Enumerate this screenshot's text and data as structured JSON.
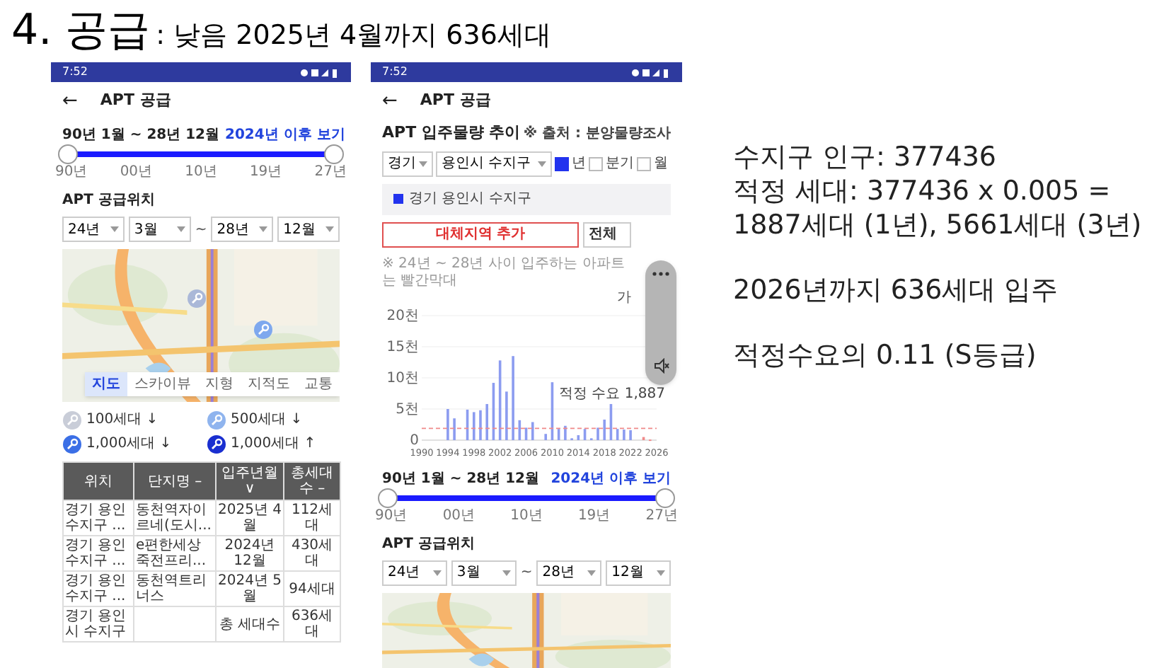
{
  "slide": {
    "title": "4. 공급",
    "subtitle": ": 낮음 2025년 4월까지 636세대"
  },
  "left_phone": {
    "status_bar": {
      "time": "7:52"
    },
    "header": {
      "back": "←",
      "title": "APT 공급"
    },
    "range": {
      "label": "90년 1월 ~ 28년 12월",
      "link": "2024년 이후 보기",
      "level": 1,
      "ticks": [
        "90년",
        "00년",
        "10년",
        "19년",
        "27년"
      ]
    },
    "location_title": "APT 공급위치",
    "period_selects": [
      "24년",
      "3월",
      "28년",
      "12월"
    ],
    "separator": "~",
    "map_tabs": [
      {
        "label": "지도",
        "selected": true
      },
      {
        "label": "스카이뷰",
        "selected": false
      },
      {
        "label": "지형",
        "selected": false
      },
      {
        "label": "지적도",
        "selected": false
      },
      {
        "label": "교통",
        "selected": false
      }
    ],
    "legend": [
      {
        "label": "100세대 ↓",
        "color": "#c9cdd8"
      },
      {
        "label": "500세대 ↓",
        "color": "#8fb4ee"
      },
      {
        "label": "1,000세대 ↓",
        "color": "#3b6fe6"
      },
      {
        "label": "1,000세대 ↑",
        "color": "#1a2fd0"
      }
    ],
    "table": {
      "columns": [
        "위치",
        "단지명 –",
        "입주년월 ∨",
        "총세대수 –"
      ],
      "rows": [
        [
          "경기 용인 수지구 ...",
          "동천역자이르네(도시...",
          "2025년 4월",
          "112세대"
        ],
        [
          "경기 용인 수지구 ...",
          "e편한세상죽전프리...",
          "2024년 12월",
          "430세대"
        ],
        [
          "경기 용인 수지구 ...",
          "동천역트리너스",
          "2024년 5월",
          "94세대"
        ]
      ],
      "total": {
        "location": "경기 용인시 수지구",
        "label": "총 세대수",
        "value": "636세대"
      }
    }
  },
  "middle_phone": {
    "status_bar": {
      "time": "7:52"
    },
    "header": {
      "back": "←",
      "title": "APT 공급"
    },
    "chart_title": "APT 입주물량 추이",
    "source": "※ 출처 : 분양물량조사",
    "region_selects": [
      "경기",
      "용인시 수지구"
    ],
    "periods": [
      {
        "label": "년",
        "checked": true
      },
      {
        "label": "분기",
        "checked": false
      },
      {
        "label": "월",
        "checked": false
      }
    ],
    "add_region_button": "대체지역 추가",
    "all_button": "전체",
    "note": "※ 24년 ~ 28년 사이 입주하는 아파트는 빨간막대",
    "chart_corner_text": "가",
    "chart": {
      "chart_data": {
        "type": "bar",
        "ylim": [
          0,
          20
        ],
        "xlim": [
          1990,
          2026
        ],
        "grid": true,
        "stacked": true,
        "yticks": [
          {
            "value": 0,
            "label": "0"
          },
          {
            "value": 5,
            "label": "5천"
          },
          {
            "value": 10,
            "label": "10천"
          },
          {
            "value": 15,
            "label": "15천"
          },
          {
            "value": 20,
            "label": "20천"
          }
        ],
        "xticks": [
          1990,
          1994,
          1998,
          2002,
          2006,
          2010,
          2014,
          2018,
          2022,
          2026
        ],
        "x": [
          1994,
          1995,
          1996,
          1997,
          1998,
          1999,
          2000,
          2001,
          2002,
          2003,
          2004,
          2005,
          2006,
          2007,
          2008,
          2009,
          2010,
          2011,
          2012,
          2013,
          2014,
          2015,
          2016,
          2017,
          2018,
          2019,
          2020,
          2021,
          2022,
          2023,
          2024,
          2025
        ],
        "series": [
          {
            "name": "경기 용인시 수지구",
            "color": "#8c9cf0",
            "values": [
              5,
              3.5,
              null,
              4.9,
              4.5,
              4.8,
              5.8,
              9.2,
              12.8,
              7.8,
              13.5,
              3.2,
              2,
              2.9,
              null,
              1,
              9.3,
              1.8,
              2.3,
              0.3,
              0.8,
              1.8,
              0.3,
              2,
              3.3,
              5.8,
              1.8,
              1.7,
              1.6,
              null,
              null,
              null
            ]
          },
          {
            "color": "#f08a8a",
            "values": [
              null,
              null,
              null,
              null,
              null,
              null,
              null,
              null,
              null,
              null,
              null,
              null,
              null,
              null,
              null,
              null,
              null,
              null,
              null,
              null,
              null,
              null,
              null,
              null,
              null,
              null,
              null,
              null,
              null,
              null,
              0.5,
              0.1
            ]
          }
        ],
        "ref_lines": [
          {
            "axis": "y",
            "value": 1.887,
            "label": "적정 수요 1,887",
            "color": "#f08a8a"
          }
        ]
      }
    },
    "range": {
      "label": "90년 1월 ~ 28년 12월",
      "link": "2024년 이후 보기",
      "level": 1,
      "ticks": [
        "90년",
        "00년",
        "10년",
        "19년",
        "27년"
      ]
    },
    "location_title": "APT 공급위치",
    "period_selects": [
      "24년",
      "3월",
      "28년",
      "12월"
    ],
    "separator": "~"
  },
  "notes": [
    {
      "lines": [
        "수지구 인구: 377436",
        "적정 세대: 377436 x 0.005 =",
        "1887세대 (1년), 5661세대 (3년)"
      ]
    },
    {
      "lines": [
        "2026년까지 636세대 입주"
      ]
    },
    {
      "lines": [
        "적정수요의 0.11 (S등급)"
      ]
    }
  ]
}
